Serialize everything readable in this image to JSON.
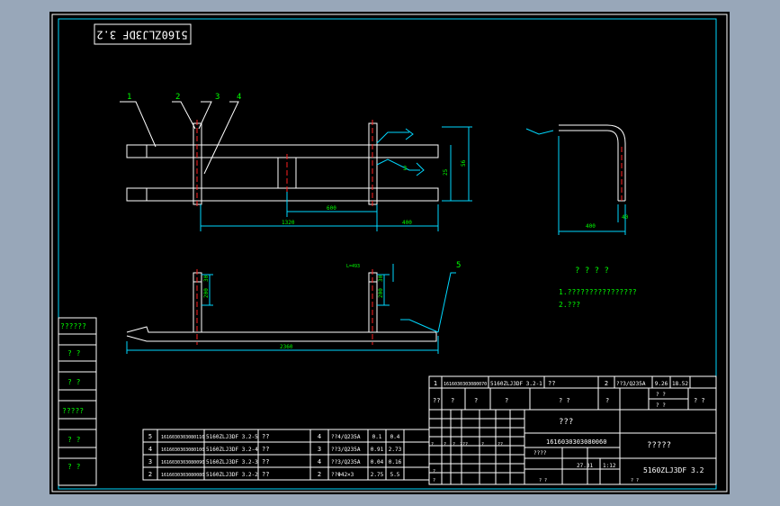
{
  "drawing_number": "5160ZLJ3DF 3.2",
  "leaders": {
    "l1": "1",
    "l2": "2",
    "l3": "3",
    "l4": "4",
    "l5": "5"
  },
  "dims": {
    "top_h1": "56",
    "top_h2": "25",
    "top_span": "1320",
    "top_mid": "600",
    "top_right": "400",
    "front_v1": "30",
    "front_v2": "200",
    "front_v3": "30",
    "front_v4": "200",
    "front_len": "2360",
    "side_w": "400",
    "side_w2": "40",
    "note_tag": "L=493"
  },
  "notes": {
    "title": "? ? ? ?",
    "line1": "1.????????????????",
    "line2": "2.???"
  },
  "left_strip": [
    "??????",
    "? ?",
    "? ?",
    "?????",
    "? ?",
    "? ?"
  ],
  "bom_rows": [
    {
      "no": "5",
      "code": "1616030303080110",
      "drawing": "5160ZLJ3DF 3.2-5",
      "name": "??",
      "qty": "4",
      "material": "??4/Q235A",
      "unit": "0.1",
      "total": "0.4"
    },
    {
      "no": "4",
      "code": "1616030303080100",
      "drawing": "5160ZLJ3DF 3.2-4",
      "name": "??",
      "qty": "3",
      "material": "??3/Q235A",
      "unit": "0.91",
      "total": "2.73"
    },
    {
      "no": "3",
      "code": "1616030303080090",
      "drawing": "5160ZLJ3DF 3.2-3",
      "name": "??",
      "qty": "4",
      "material": "??3/Q235A",
      "unit": "0.04",
      "total": "0.16"
    },
    {
      "no": "2",
      "code": "1616030303080080",
      "drawing": "5160ZLJ3DF 3.2-2",
      "name": "??",
      "qty": "2",
      "material": "??Φ42×3",
      "unit": "2.75",
      "total": "5.5"
    }
  ],
  "title_block": {
    "row1": {
      "no": "1",
      "code": "1616030303080070",
      "drawing": "5160ZLJ3DF 3.2-1",
      "name": "??",
      "qty": "2",
      "material": "??3/Q235A",
      "unit": "9.26",
      "total": "18.52"
    },
    "row2": [
      "??",
      "?",
      "?",
      "?",
      "? ?",
      "?",
      "? ?"
    ],
    "row2b": [
      "? ?",
      "? ?"
    ],
    "part_name": "???",
    "part_code": "1616030303080060",
    "company": "?????",
    "drawing_no": "5160ZLJ3DF 3.2",
    "scale": "1:12",
    "sheet": "1:12",
    "weight": "27.31",
    "counter": "????",
    "small": [
      "?",
      "?",
      "?",
      "?",
      "??",
      "???",
      "?",
      "?",
      "? ?",
      "? ?"
    ]
  }
}
